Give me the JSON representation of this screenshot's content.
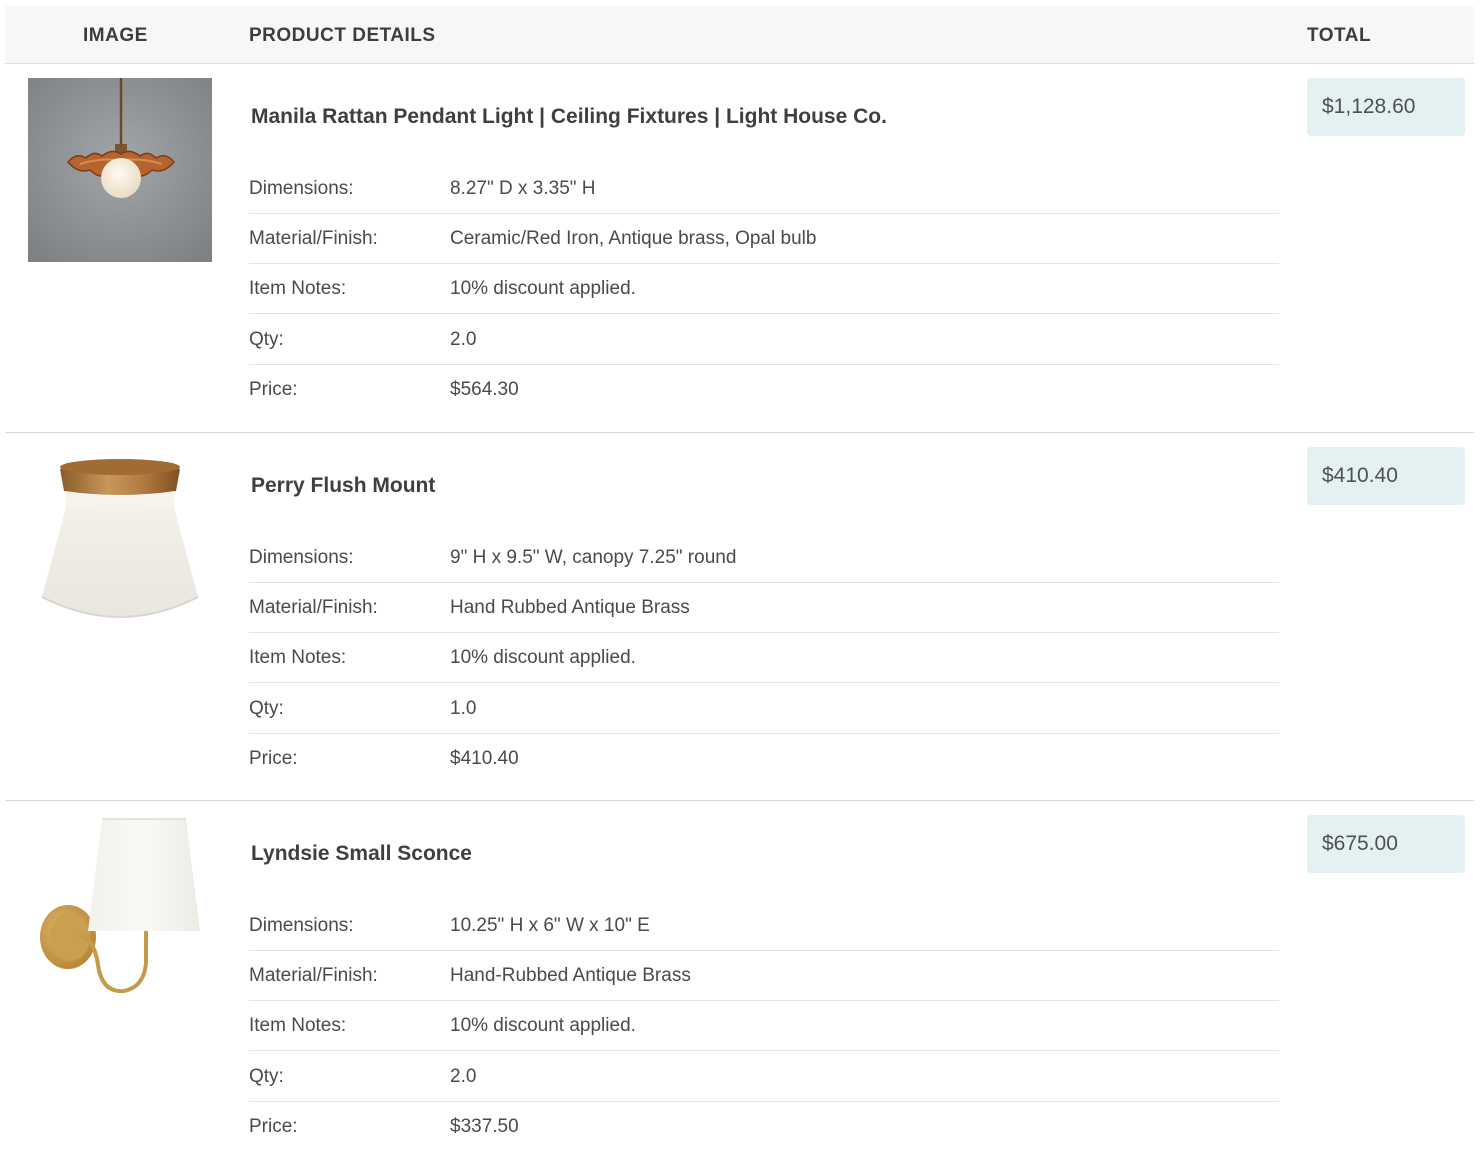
{
  "table": {
    "headers": {
      "image": "IMAGE",
      "details": "PRODUCT DETAILS",
      "total": "TOTAL"
    },
    "spec_labels": {
      "dimensions": "Dimensions:",
      "material": "Material/Finish:",
      "notes": "Item Notes:",
      "qty": "Qty:",
      "price": "Price:"
    },
    "items": [
      {
        "title": "Manila Rattan Pendant Light | Ceiling Fixtures | Light House Co.",
        "dimensions": "8.27\" D x 3.35\" H",
        "material": "Ceramic/Red Iron, Antique brass, Opal bulb",
        "notes": "10% discount applied.",
        "qty": "2.0",
        "price": "$564.30",
        "total": "$1,128.60"
      },
      {
        "title": "Perry Flush Mount",
        "dimensions": "9\" H x 9.5\" W, canopy 7.25\" round",
        "material": "Hand Rubbed Antique Brass",
        "notes": "10% discount applied.",
        "qty": "1.0",
        "price": "$410.40",
        "total": "$410.40"
      },
      {
        "title": "Lyndsie Small Sconce",
        "dimensions": "10.25\" H x 6\" W x 10\" E",
        "material": "Hand-Rubbed Antique Brass",
        "notes": "10% discount applied.",
        "qty": "2.0",
        "price": "$337.50",
        "total": "$675.00"
      }
    ]
  },
  "colors": {
    "header_bg": "#f6f8f7",
    "total_bg": "#e4f1f2",
    "divider": "#d7d9d8",
    "text": "#4a4a4a"
  }
}
